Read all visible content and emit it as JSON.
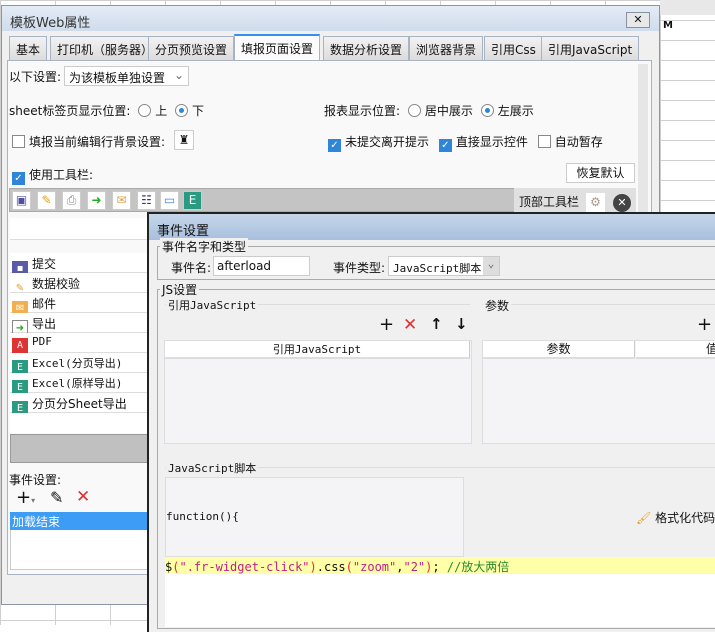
{
  "main_dialog": {
    "title": "模板Web属性",
    "close": "✕",
    "tabs": [
      "基本",
      "打印机（服务器）",
      "分页预览设置",
      "填报页面设置",
      "数据分析设置",
      "浏览器背景",
      "引用Css",
      "引用JavaScript"
    ],
    "active_tab": "填报页面设置",
    "settings_label": "以下设置:",
    "settings_value": "为该模板单独设置",
    "sheet_label": "sheet标签页显示位置:",
    "sheet_options": [
      "上",
      "下"
    ],
    "sheet_selected": "下",
    "report_pos_label": "报表显示位置:",
    "report_pos_options": [
      "居中展示",
      "左展示"
    ],
    "report_pos_selected": "左展示",
    "edit_row_bg": "填报当前编辑行背景设置:",
    "unsubmitted_prompt": "未提交离开提示",
    "show_widget": "直接显示控件",
    "auto_save": "自动暂存",
    "use_toolbar": "使用工具栏:",
    "restore_default": "恢复默认",
    "top_toolbar": "顶部工具栏",
    "toolbar_items": [
      "提交",
      "数据校验",
      "邮件",
      "导出",
      "PDF",
      "Excel(分页导出)",
      "Excel(原样导出)",
      "分页分Sheet导出"
    ],
    "event_label": "事件设置:",
    "events": [
      "加载结束"
    ]
  },
  "event_dialog": {
    "title": "事件设置",
    "group_name_type": "事件名字和类型",
    "event_name_label": "事件名:",
    "event_name_value": "afterload",
    "event_type_label": "事件类型:",
    "event_type_value": "JavaScript脚本",
    "js_group": "JS设置",
    "ref_js_label": "引用JavaScript",
    "params_label": "参数",
    "ref_js_col": "引用JavaScript",
    "param_cols": [
      "参数",
      "值"
    ],
    "script_label": "JavaScript脚本",
    "function_header": "function(){",
    "format_code": "格式化代码",
    "code": {
      "dollar": "$",
      "p1": "(",
      "s1": "\".fr-widget-click\"",
      "p2": ")",
      ".css": ".css",
      "p3": "(",
      "s2": "\"zoom\"",
      "comma": ",",
      "s3": "\"2\"",
      "p4": ")",
      "semi": "; ",
      "comment": "//放大两倍"
    }
  },
  "spreadsheet": {
    "col_header": "M"
  }
}
